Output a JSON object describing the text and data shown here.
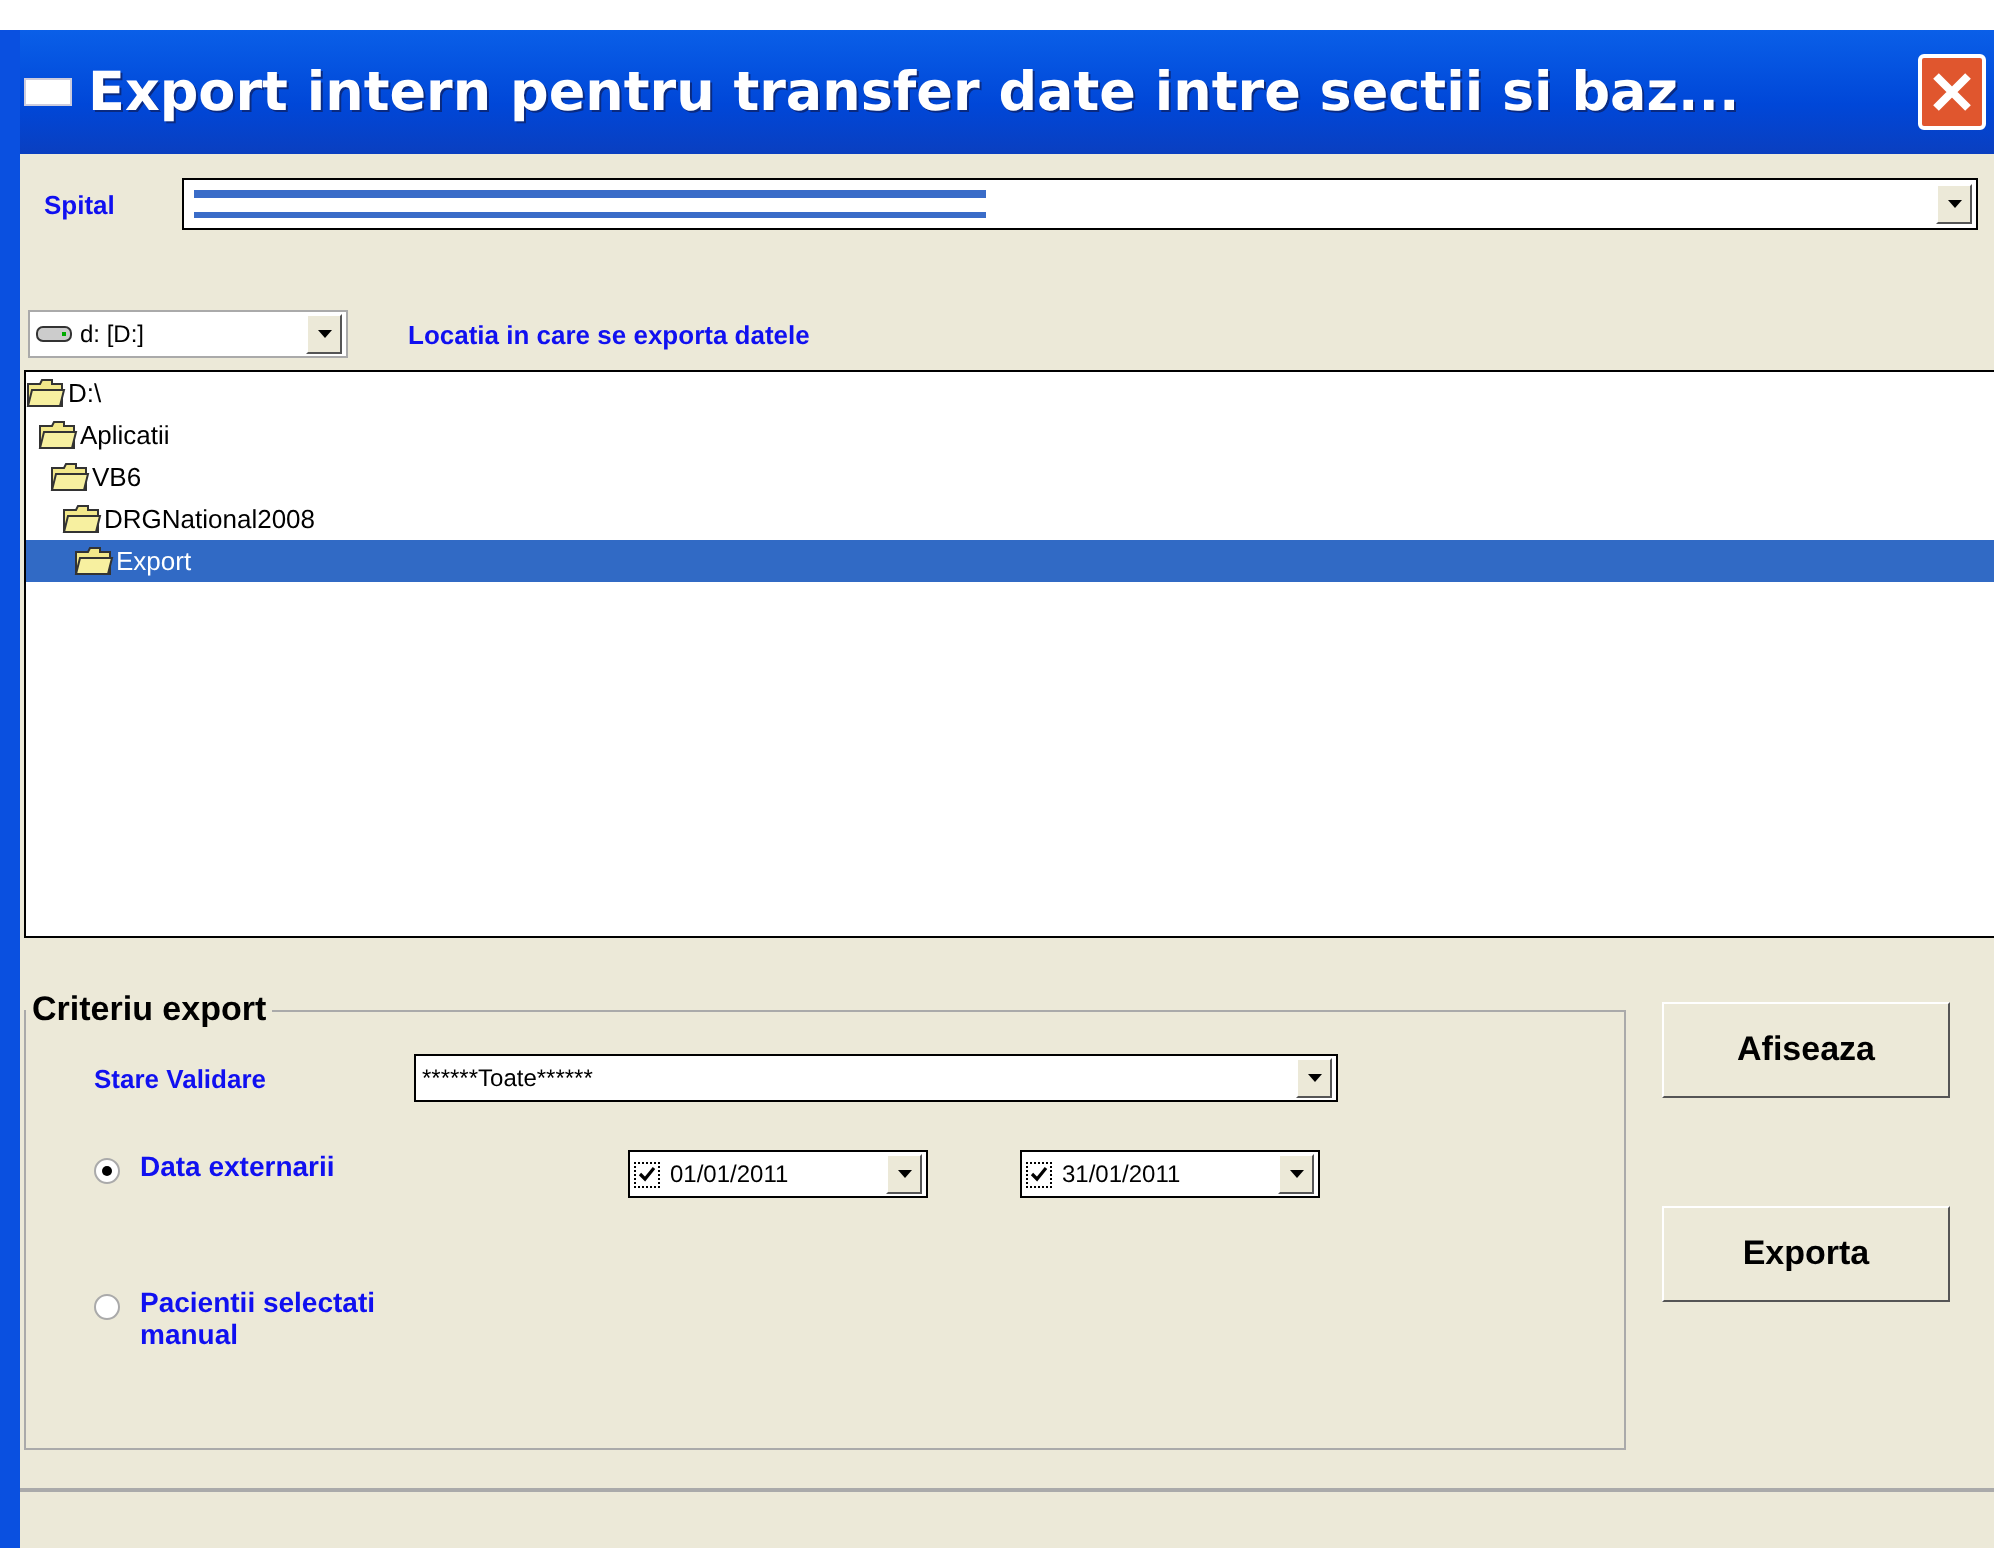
{
  "window": {
    "title": "Export intern pentru transfer date intre sectii si baz..."
  },
  "spital": {
    "label": "Spital"
  },
  "drive": {
    "value": "d: [D:]"
  },
  "location_label": "Locatia in care se exporta datele",
  "folders": [
    {
      "name": "D:\\",
      "selected": false,
      "children": [
        {
          "name": "Aplicatii",
          "selected": false,
          "children": [
            {
              "name": "VB6",
              "selected": false,
              "children": [
                {
                  "name": "DRGNational2008",
                  "selected": false,
                  "children": [
                    {
                      "name": "Export",
                      "selected": true
                    }
                  ]
                }
              ]
            }
          ]
        }
      ]
    }
  ],
  "criteria": {
    "title": "Criteriu export",
    "stare_validare": {
      "label": "Stare Validare",
      "value": "******Toate******"
    },
    "options": [
      {
        "label": "Data externarii",
        "selected": true,
        "dates": [
          {
            "value": "01/01/2011",
            "checked": true
          },
          {
            "value": "31/01/2011",
            "checked": true
          }
        ]
      },
      {
        "label": "Pacientii selectati manual",
        "selected": false
      }
    ]
  },
  "buttons": [
    "Afiseaza",
    "Exporta"
  ]
}
